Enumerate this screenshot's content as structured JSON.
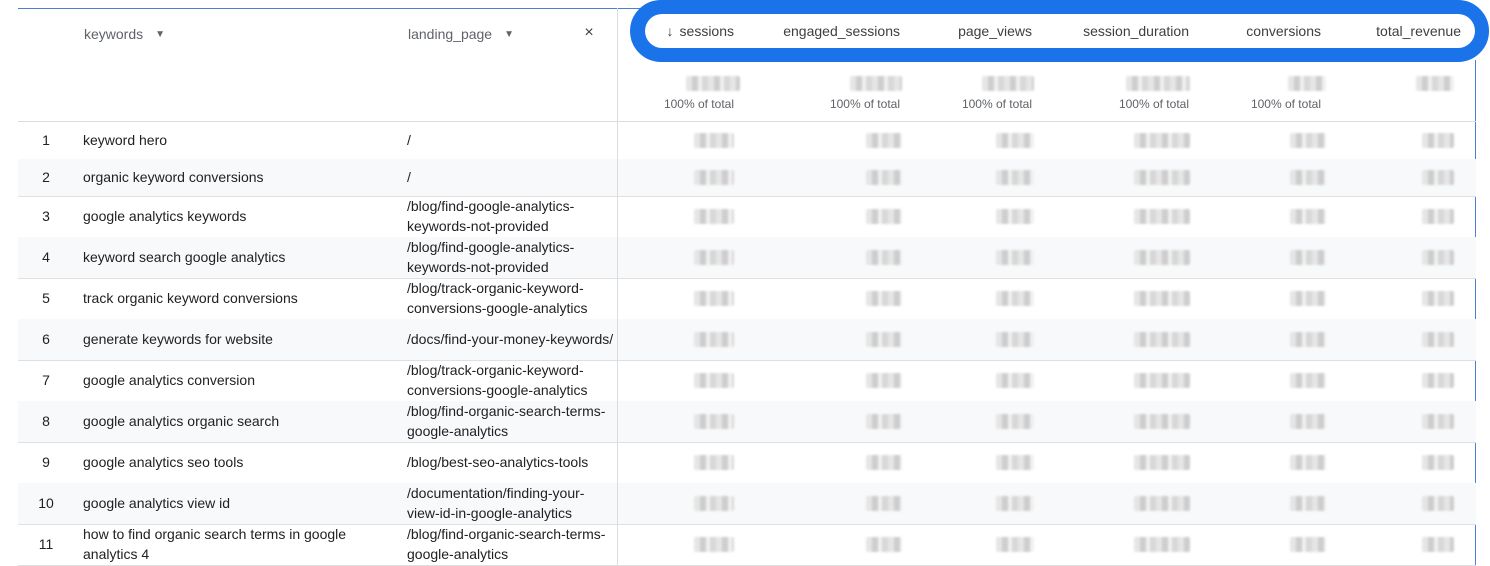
{
  "headers": {
    "dimensions": [
      {
        "label": "keywords"
      },
      {
        "label": "landing_page"
      }
    ],
    "close_symbol": "×",
    "sort_symbol": "↓",
    "metrics": [
      "sessions",
      "engaged_sessions",
      "page_views",
      "session_duration",
      "conversions",
      "total_revenue"
    ]
  },
  "totals": {
    "pct_label": "100% of total",
    "shows_pct": [
      true,
      true,
      true,
      true,
      true,
      false
    ]
  },
  "highlight_color": "#1a73e8",
  "rows": [
    {
      "n": "1",
      "keyword": "keyword hero",
      "landing": "/"
    },
    {
      "n": "2",
      "keyword": "organic keyword conversions",
      "landing": "/"
    },
    {
      "n": "3",
      "keyword": "google analytics keywords",
      "landing": "/blog/find-google-analytics-keywords-not-provided"
    },
    {
      "n": "4",
      "keyword": "keyword search google analytics",
      "landing": "/blog/find-google-analytics-keywords-not-provided"
    },
    {
      "n": "5",
      "keyword": "track organic keyword conversions",
      "landing": "/blog/track-organic-keyword-conversions-google-analytics"
    },
    {
      "n": "6",
      "keyword": "generate keywords for website",
      "landing": "/docs/find-your-money-keywords/"
    },
    {
      "n": "7",
      "keyword": "google analytics conversion",
      "landing": "/blog/track-organic-keyword-conversions-google-analytics"
    },
    {
      "n": "8",
      "keyword": "google analytics organic search",
      "landing": "/blog/find-organic-search-terms-google-analytics"
    },
    {
      "n": "9",
      "keyword": "google analytics seo tools",
      "landing": "/blog/best-seo-analytics-tools"
    },
    {
      "n": "10",
      "keyword": "google analytics view id",
      "landing": "/documentation/finding-your-view-id-in-google-analytics"
    },
    {
      "n": "11",
      "keyword": "how to find organic search terms in google analytics 4",
      "landing": "/blog/find-organic-search-terms-google-analytics"
    }
  ]
}
